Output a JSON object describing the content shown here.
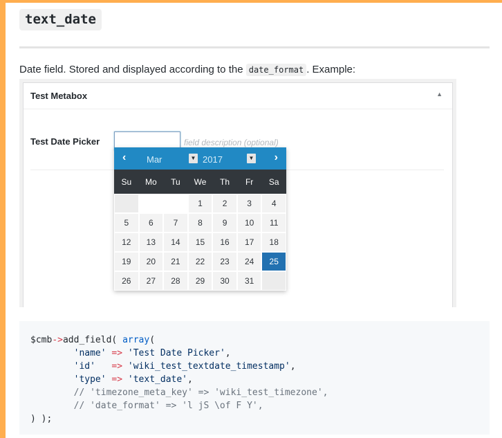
{
  "heading": "text_date",
  "intro": {
    "before": "Date field. Stored and displayed according to the",
    "code": "date_format",
    "after": ". Example:"
  },
  "metabox": {
    "title": "Test Metabox",
    "toggle_icon": "triangle-up-icon",
    "field_label": "Test Date Picker",
    "input_value": "",
    "field_description": "field description (optional)"
  },
  "datepicker": {
    "prev": "<",
    "next": ">",
    "month": "Mar",
    "year": "2017",
    "weekdays": [
      "Su",
      "Mo",
      "Tu",
      "We",
      "Th",
      "Fr",
      "Sa"
    ],
    "days": [
      [
        "",
        "",
        "",
        "1",
        "2",
        "3",
        "4"
      ],
      [
        "5",
        "6",
        "7",
        "8",
        "9",
        "10",
        "11"
      ],
      [
        "12",
        "13",
        "14",
        "15",
        "16",
        "17",
        "18"
      ],
      [
        "19",
        "20",
        "21",
        "22",
        "23",
        "24",
        "25"
      ],
      [
        "26",
        "27",
        "28",
        "29",
        "30",
        "31",
        ""
      ]
    ],
    "selected_day": "25",
    "selected_color": "#2271b1",
    "header_color": "#2189c4"
  },
  "code": {
    "lines": [
      [
        {
          "t": "$cmb",
          "c": "var"
        },
        {
          "t": "->",
          "c": "op"
        },
        {
          "t": "add_field( ",
          "c": "fn"
        },
        {
          "t": "array",
          "c": "kw"
        },
        {
          "t": "(",
          "c": "fn"
        }
      ],
      [
        {
          "t": "        ",
          "c": "fn"
        },
        {
          "t": "'name'",
          "c": "str"
        },
        {
          "t": " => ",
          "c": "op"
        },
        {
          "t": "'Test Date Picker'",
          "c": "str"
        },
        {
          "t": ",",
          "c": "fn"
        }
      ],
      [
        {
          "t": "        ",
          "c": "fn"
        },
        {
          "t": "'id'",
          "c": "str"
        },
        {
          "t": "   => ",
          "c": "op"
        },
        {
          "t": "'wiki_test_textdate_timestamp'",
          "c": "str"
        },
        {
          "t": ",",
          "c": "fn"
        }
      ],
      [
        {
          "t": "        ",
          "c": "fn"
        },
        {
          "t": "'type'",
          "c": "str"
        },
        {
          "t": " => ",
          "c": "op"
        },
        {
          "t": "'text_date'",
          "c": "str"
        },
        {
          "t": ",",
          "c": "fn"
        }
      ],
      [
        {
          "t": "        // 'timezone_meta_key' => 'wiki_test_timezone',",
          "c": "com"
        }
      ],
      [
        {
          "t": "        // 'date_format' => 'l jS \\of F Y',",
          "c": "com"
        }
      ],
      [
        {
          "t": ") );",
          "c": "fn"
        }
      ]
    ]
  }
}
